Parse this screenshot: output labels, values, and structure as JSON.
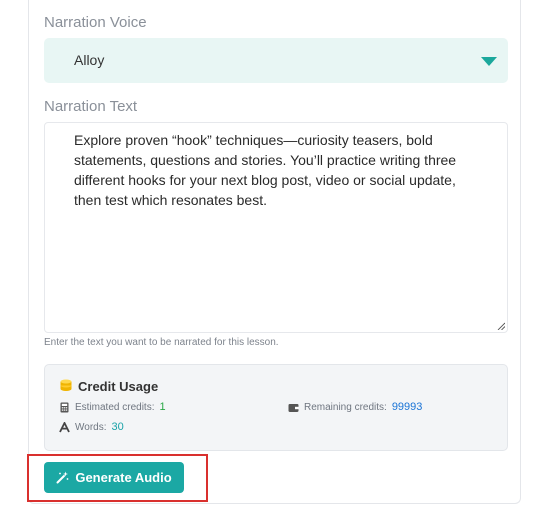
{
  "narration_voice": {
    "label": "Narration Voice",
    "selected": "Alloy"
  },
  "narration_text": {
    "label": "Narration Text",
    "value": "Explore proven “hook” techniques—curiosity teasers, bold statements, questions and stories. You’ll practice writing three different hooks for your next blog post, video or social update, then test which resonates best.",
    "helper": "Enter the text you want to be narrated for this lesson."
  },
  "credit_usage": {
    "title": "Credit Usage",
    "estimated_label": "Estimated credits:",
    "estimated_value": "1",
    "remaining_label": "Remaining credits:",
    "remaining_value": "99993",
    "words_label": "Words:",
    "words_value": "30"
  },
  "generate_button": {
    "label": "Generate Audio"
  },
  "colors": {
    "accent": "#1ba8a4",
    "highlight": "#d9302e",
    "select_bg": "#e8f6f4"
  }
}
